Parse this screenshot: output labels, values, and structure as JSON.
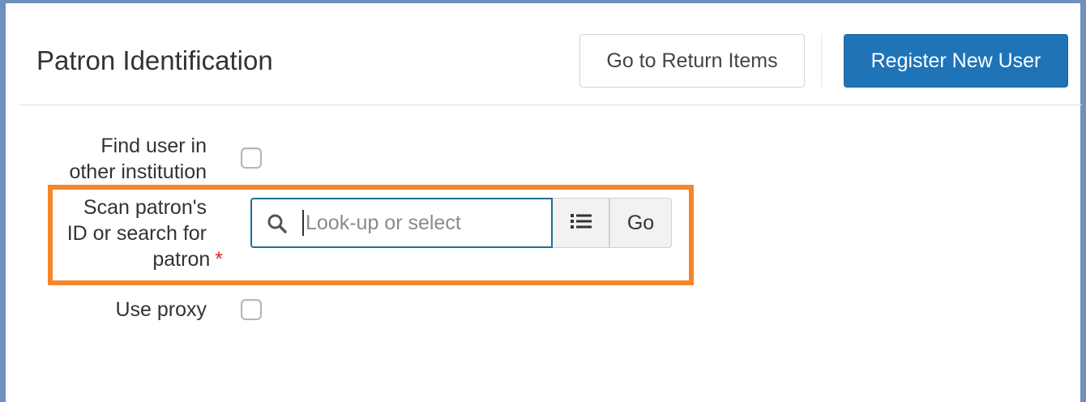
{
  "header": {
    "title": "Patron Identification",
    "return_items_label": "Go to Return Items",
    "register_user_label": "Register New User"
  },
  "form": {
    "find_other_institution": {
      "label_line1": "Find user in",
      "label_line2": "other institution",
      "checked": false
    },
    "scan_patron": {
      "label_line1": "Scan patron's",
      "label_line2": "ID or search for",
      "label_line3": "patron",
      "required_mark": "*",
      "placeholder": "Look-up or select",
      "value": "",
      "go_label": "Go"
    },
    "use_proxy": {
      "label": "Use proxy",
      "checked": false
    }
  },
  "icons": {
    "search": "search-icon",
    "list": "list-icon"
  },
  "colors": {
    "primary_button": "#1f74b8",
    "highlight_border": "#f5862a",
    "input_focus_border": "#1f6e91",
    "required": "#d9251d",
    "window_frame": "#6f8fbf"
  }
}
